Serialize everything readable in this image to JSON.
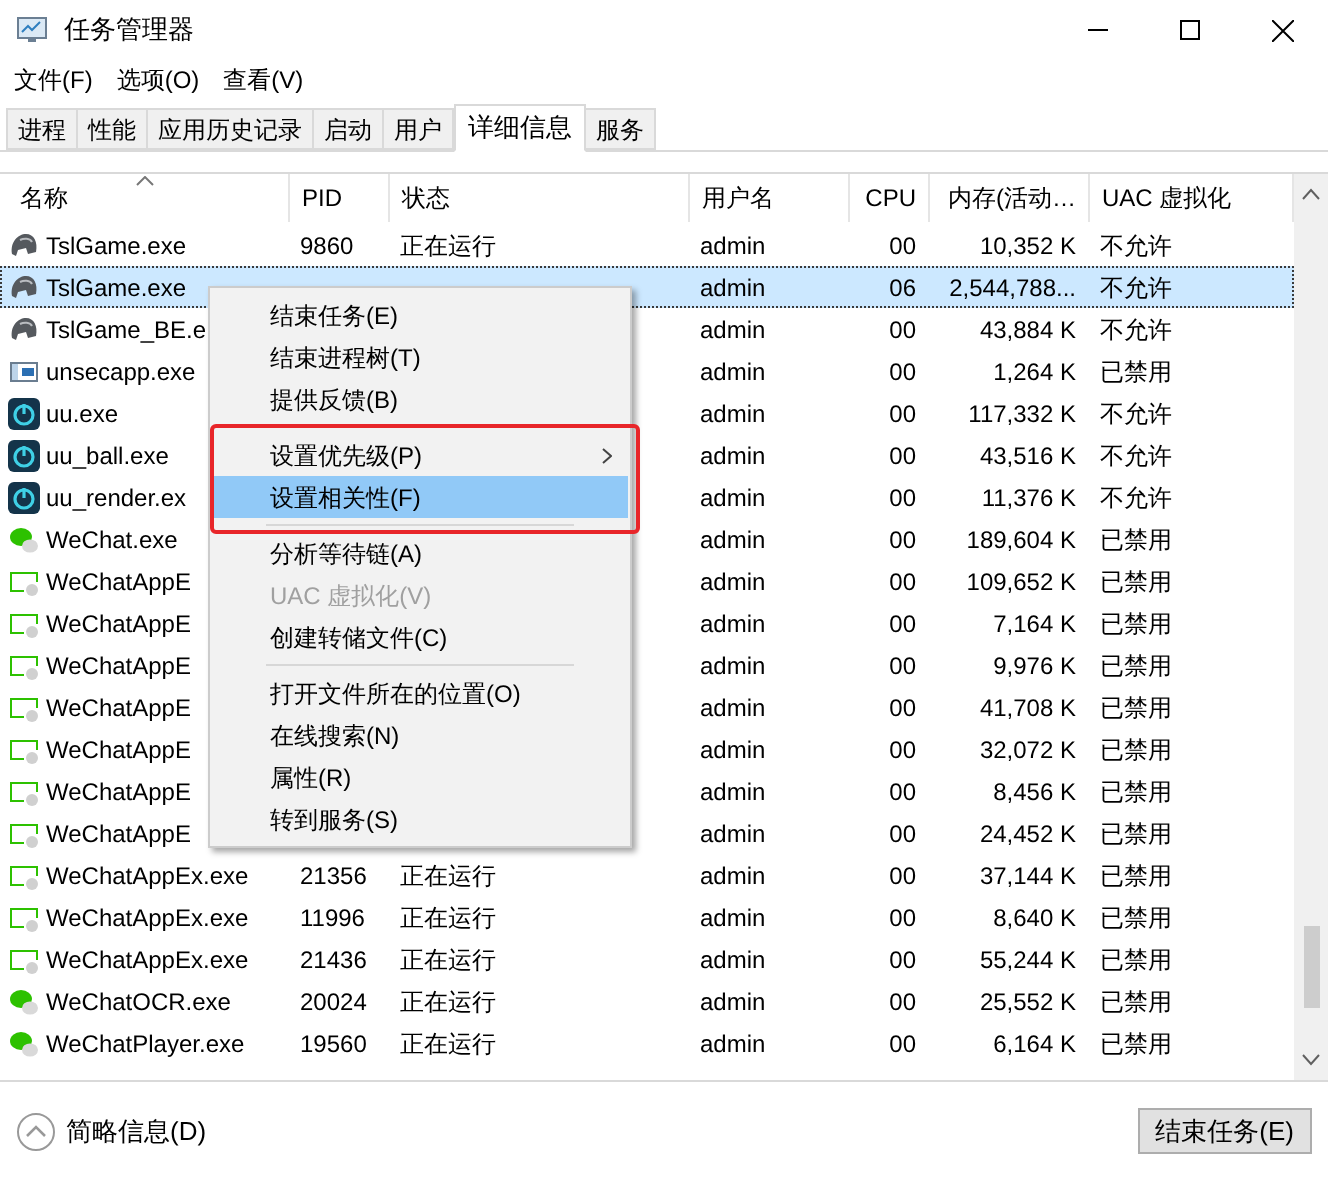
{
  "window": {
    "title": "任务管理器"
  },
  "menu_bar": [
    "文件(F)",
    "选项(O)",
    "查看(V)"
  ],
  "tabs": [
    {
      "label": "进程",
      "selected": false
    },
    {
      "label": "性能",
      "selected": false
    },
    {
      "label": "应用历史记录",
      "selected": false
    },
    {
      "label": "启动",
      "selected": false
    },
    {
      "label": "用户",
      "selected": false
    },
    {
      "label": "详细信息",
      "selected": true
    },
    {
      "label": "服务",
      "selected": false
    }
  ],
  "table": {
    "columns": [
      "名称",
      "PID",
      "状态",
      "用户名",
      "CPU",
      "内存(活动…",
      "UAC 虚拟化"
    ],
    "rows": [
      {
        "kind": "game",
        "name": "TslGame.exe",
        "pid": "9860",
        "status": "正在运行",
        "user": "admin",
        "cpu": "00",
        "memory": "10,352 K",
        "uac": "不允许",
        "selected": false
      },
      {
        "kind": "game",
        "name": "TslGame.exe",
        "user": "admin",
        "cpu": "06",
        "memory": "2,544,788...",
        "uac": "不允许",
        "selected": true
      },
      {
        "kind": "game",
        "name": "TslGame_BE.e",
        "user": "admin",
        "cpu": "00",
        "memory": "43,884 K",
        "uac": "不允许",
        "selected": false
      },
      {
        "kind": "window",
        "name": "unsecapp.exe",
        "user": "admin",
        "cpu": "00",
        "memory": "1,264 K",
        "uac": "已禁用",
        "selected": false
      },
      {
        "kind": "uu",
        "name": "uu.exe",
        "user": "admin",
        "cpu": "00",
        "memory": "117,332 K",
        "uac": "不允许",
        "selected": false
      },
      {
        "kind": "uu",
        "name": "uu_ball.exe",
        "user": "admin",
        "cpu": "00",
        "memory": "43,516 K",
        "uac": "不允许",
        "selected": false
      },
      {
        "kind": "uu",
        "name": "uu_render.ex",
        "user": "admin",
        "cpu": "00",
        "memory": "11,376 K",
        "uac": "不允许",
        "selected": false
      },
      {
        "kind": "wechat",
        "name": "WeChat.exe",
        "user": "admin",
        "cpu": "00",
        "memory": "189,604 K",
        "uac": "已禁用",
        "selected": false
      },
      {
        "kind": "app",
        "name": "WeChatAppE",
        "user": "admin",
        "cpu": "00",
        "memory": "109,652 K",
        "uac": "已禁用",
        "selected": false
      },
      {
        "kind": "app",
        "name": "WeChatAppE",
        "user": "admin",
        "cpu": "00",
        "memory": "7,164 K",
        "uac": "已禁用",
        "selected": false
      },
      {
        "kind": "app",
        "name": "WeChatAppE",
        "user": "admin",
        "cpu": "00",
        "memory": "9,976 K",
        "uac": "已禁用",
        "selected": false
      },
      {
        "kind": "app",
        "name": "WeChatAppE",
        "user": "admin",
        "cpu": "00",
        "memory": "41,708 K",
        "uac": "已禁用",
        "selected": false
      },
      {
        "kind": "app",
        "name": "WeChatAppE",
        "user": "admin",
        "cpu": "00",
        "memory": "32,072 K",
        "uac": "已禁用",
        "selected": false
      },
      {
        "kind": "app",
        "name": "WeChatAppE",
        "user": "admin",
        "cpu": "00",
        "memory": "8,456 K",
        "uac": "已禁用",
        "selected": false
      },
      {
        "kind": "app",
        "name": "WeChatAppE",
        "user": "admin",
        "cpu": "00",
        "memory": "24,452 K",
        "uac": "已禁用",
        "selected": false
      },
      {
        "kind": "app",
        "name": "WeChatAppEx.exe",
        "pid": "21356",
        "status": "正在运行",
        "user": "admin",
        "cpu": "00",
        "memory": "37,144 K",
        "uac": "已禁用",
        "selected": false
      },
      {
        "kind": "app",
        "name": "WeChatAppEx.exe",
        "pid": "11996",
        "status": "正在运行",
        "user": "admin",
        "cpu": "00",
        "memory": "8,640 K",
        "uac": "已禁用",
        "selected": false
      },
      {
        "kind": "app",
        "name": "WeChatAppEx.exe",
        "pid": "21436",
        "status": "正在运行",
        "user": "admin",
        "cpu": "00",
        "memory": "55,244 K",
        "uac": "已禁用",
        "selected": false
      },
      {
        "kind": "wechat",
        "name": "WeChatOCR.exe",
        "pid": "20024",
        "status": "正在运行",
        "user": "admin",
        "cpu": "00",
        "memory": "25,552 K",
        "uac": "已禁用",
        "selected": false
      },
      {
        "kind": "wechat",
        "name": "WeChatPlayer.exe",
        "pid": "19560",
        "status": "正在运行",
        "user": "admin",
        "cpu": "00",
        "memory": "6,164 K",
        "uac": "已禁用",
        "selected": false
      }
    ]
  },
  "context_menu": {
    "groups": [
      {
        "outlined": false,
        "items": [
          {
            "label": "结束任务(E)",
            "disabled": false,
            "selected": false,
            "submenu": false
          },
          {
            "label": "结束进程树(T)",
            "disabled": false,
            "selected": false,
            "submenu": false
          },
          {
            "label": "提供反馈(B)",
            "disabled": false,
            "selected": false,
            "submenu": false
          }
        ]
      },
      {
        "outlined": true,
        "items": [
          {
            "label": "设置优先级(P)",
            "disabled": false,
            "selected": false,
            "submenu": true
          },
          {
            "label": "设置相关性(F)",
            "disabled": false,
            "selected": true,
            "submenu": false
          }
        ]
      },
      {
        "outlined": false,
        "items": [
          {
            "label": "分析等待链(A)",
            "disabled": false,
            "selected": false,
            "submenu": false
          },
          {
            "label": "UAC 虚拟化(V)",
            "disabled": true,
            "selected": false,
            "submenu": false
          },
          {
            "label": "创建转储文件(C)",
            "disabled": false,
            "selected": false,
            "submenu": false
          }
        ]
      },
      {
        "outlined": false,
        "items": [
          {
            "label": "打开文件所在的位置(O)",
            "disabled": false,
            "selected": false,
            "submenu": false
          },
          {
            "label": "在线搜索(N)",
            "disabled": false,
            "selected": false,
            "submenu": false
          },
          {
            "label": "属性(R)",
            "disabled": false,
            "selected": false,
            "submenu": false
          },
          {
            "label": "转到服务(S)",
            "disabled": false,
            "selected": false,
            "submenu": false
          }
        ]
      }
    ]
  },
  "footer": {
    "details_toggle": "简略信息(D)",
    "end_task_button": "结束任务(E)"
  }
}
